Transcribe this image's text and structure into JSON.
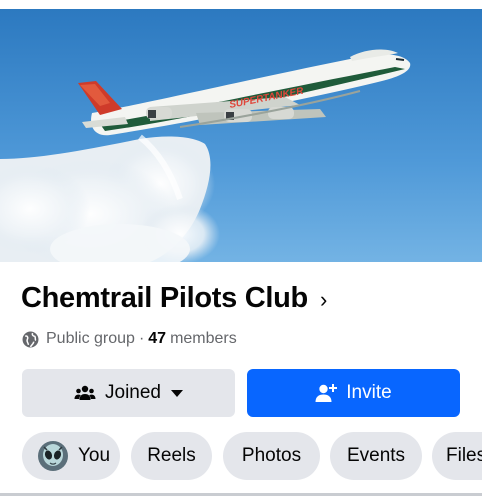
{
  "group": {
    "name": "Chemtrail Pilots Club",
    "privacy": "Public group",
    "separator": "·",
    "member_count": "47",
    "member_label": "members"
  },
  "cover": {
    "aircraft_text": "SUPERTANKER"
  },
  "actions": {
    "joined_label": "Joined",
    "invite_label": "Invite"
  },
  "tabs": [
    {
      "label": "You"
    },
    {
      "label": "Reels"
    },
    {
      "label": "Photos"
    },
    {
      "label": "Events"
    },
    {
      "label": "Files"
    }
  ],
  "icons": {
    "title": "chevron-right-icon",
    "privacy": "globe-icon",
    "joined": "people-icon",
    "joined_dropdown": "caret-down-icon",
    "invite": "add-person-icon",
    "you_avatar": "alien-avatar"
  },
  "colors": {
    "primary": "#0866ff",
    "secondary_button": "#e4e6eb",
    "secondary_text": "#65676b",
    "sky": "#4d97d6"
  }
}
